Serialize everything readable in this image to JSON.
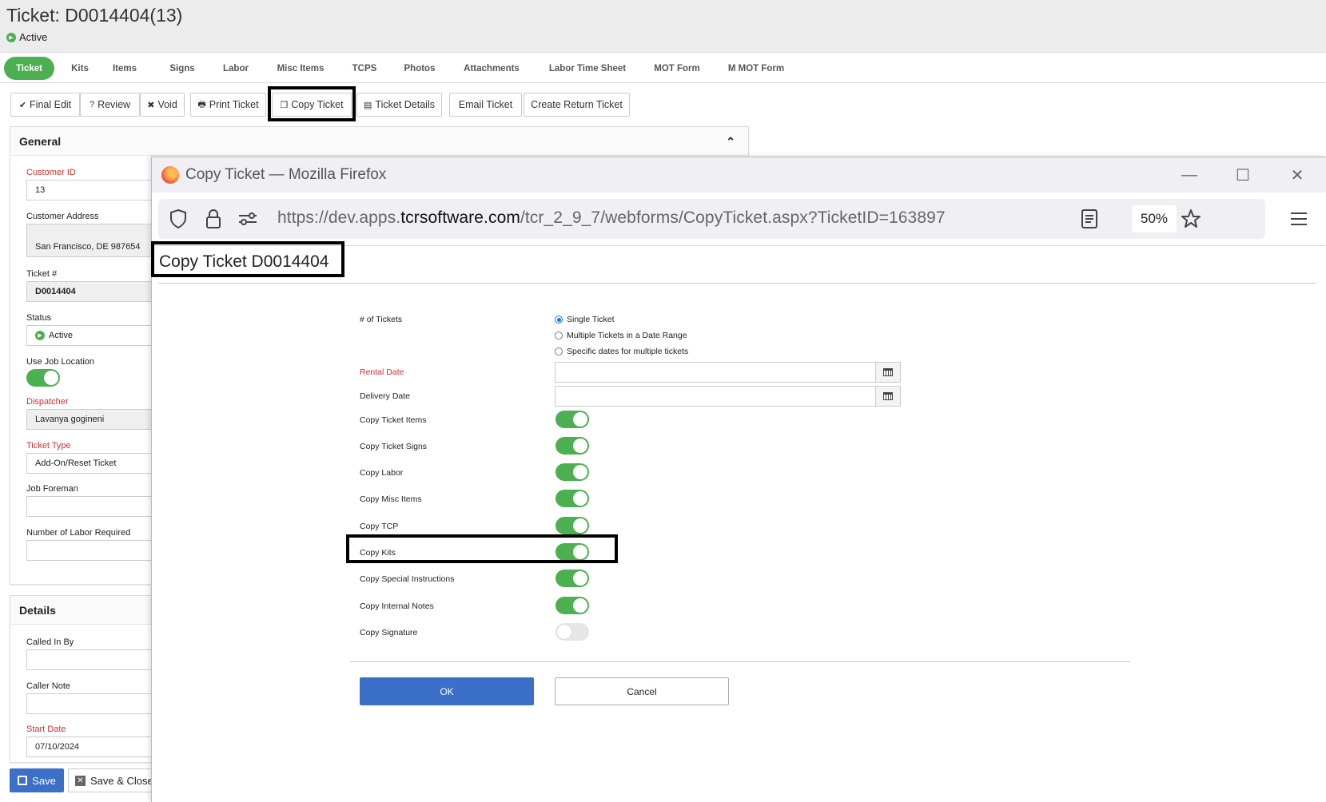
{
  "ticket": {
    "title": "Ticket: D0014404(13)",
    "status": "Active"
  },
  "tabs": [
    "Ticket",
    "Kits",
    "Items",
    "Signs",
    "Labor",
    "Misc Items",
    "TCPS",
    "Photos",
    "Attachments",
    "Labor Time Sheet",
    "MOT Form",
    "M MOT Form"
  ],
  "toolbar": {
    "final_edit": "Final Edit",
    "review": "Review",
    "void": "Void",
    "print_ticket": "Print Ticket",
    "copy_ticket": "Copy Ticket",
    "ticket_details": "Ticket Details",
    "email_ticket": "Email Ticket",
    "create_return_ticket": "Create Return Ticket"
  },
  "general": {
    "heading": "General",
    "customer_id_label": "Customer ID",
    "customer_id": "13",
    "customer_address_label": "Customer Address",
    "customer_address": "San Francisco, DE  987654",
    "ticket_no_label": "Ticket #",
    "ticket_no": "D0014404",
    "status_label": "Status",
    "status": "Active",
    "use_job_location_label": "Use Job Location",
    "dispatcher_label": "Dispatcher",
    "dispatcher": "Lavanya gogineni",
    "ticket_type_label": "Ticket Type",
    "ticket_type": "Add-On/Reset Ticket",
    "job_foreman_label": "Job Foreman",
    "labor_required_label": "Number of Labor Required"
  },
  "details": {
    "heading": "Details",
    "called_in_by_label": "Called In By",
    "caller_note_label": "Caller Note",
    "start_date_label": "Start Date",
    "start_date": "07/10/2024"
  },
  "footer": {
    "save": "Save",
    "save_close": "Save & Close"
  },
  "browser": {
    "window_title": "Copy Ticket — Mozilla Firefox",
    "url_prefix": "https://dev.apps.",
    "url_domain": "tcrsoftware.com",
    "url_path": "/tcr_2_9_7/webforms/CopyTicket.aspx?TicketID=163897",
    "zoom": "50%"
  },
  "dialog": {
    "title": "Copy Ticket D0014404",
    "num_tickets_label": "# of Tickets",
    "radio_options": [
      "Single Ticket",
      "Multiple Tickets in a Date Range",
      "Specific dates for multiple tickets"
    ],
    "selected_radio": "Single Ticket",
    "rental_date_label": "Rental Date",
    "delivery_date_label": "Delivery Date",
    "toggles": [
      {
        "label": "Copy Ticket Items",
        "on": true
      },
      {
        "label": "Copy Ticket Signs",
        "on": true
      },
      {
        "label": "Copy Labor",
        "on": true
      },
      {
        "label": "Copy Misc Items",
        "on": true
      },
      {
        "label": "Copy TCP",
        "on": true
      },
      {
        "label": "Copy Kits",
        "on": true
      },
      {
        "label": "Copy Special Instructions",
        "on": true
      },
      {
        "label": "Copy Internal Notes",
        "on": true
      },
      {
        "label": "Copy Signature",
        "on": false
      }
    ],
    "ok": "OK",
    "cancel": "Cancel"
  },
  "colors": {
    "accent_green": "#4caf50",
    "primary_blue": "#3b6fc8",
    "required_red": "#d32f2f"
  }
}
